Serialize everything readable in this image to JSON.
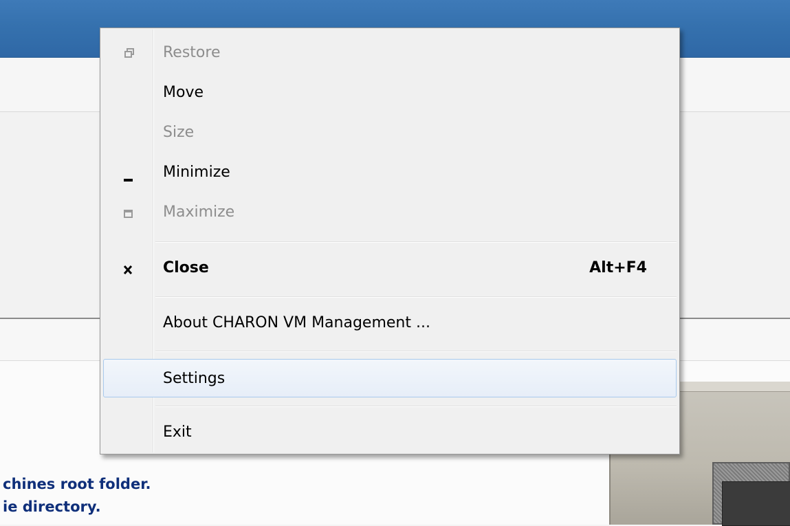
{
  "background": {
    "text_lines": [
      "chines root folder.",
      "ie directory."
    ]
  },
  "menu": {
    "items": [
      {
        "label": "Restore",
        "icon": "restore-icon",
        "disabled": true
      },
      {
        "label": "Move",
        "disabled": false
      },
      {
        "label": "Size",
        "disabled": true
      },
      {
        "label": "Minimize",
        "icon": "minimize-icon",
        "disabled": false
      },
      {
        "label": "Maximize",
        "icon": "maximize-icon",
        "disabled": true
      },
      {
        "label": "Close",
        "icon": "close-icon",
        "shortcut": "Alt+F4",
        "bold": true,
        "disabled": false
      },
      {
        "label": "About CHARON VM Management ...",
        "disabled": false
      },
      {
        "label": "Settings",
        "highlighted": true,
        "disabled": false
      },
      {
        "label": "Exit",
        "disabled": false
      }
    ]
  },
  "colors": {
    "titlebar": "#3571ae",
    "menu_background": "#f0f0f0",
    "highlight_border": "#a8c9ec",
    "disabled_text": "#8d8d8d",
    "background_text": "#0f2f7a"
  }
}
